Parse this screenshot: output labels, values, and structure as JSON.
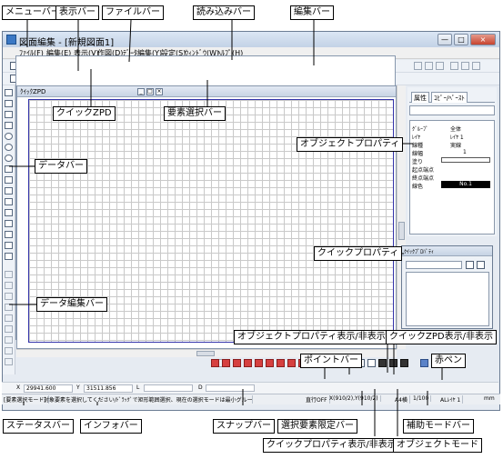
{
  "window": {
    "title": "図面編集 - [新規図面1]",
    "buttons": [
      "—",
      "□",
      "×"
    ]
  },
  "menu": [
    "ﾌｧｲﾙ(F)",
    "編集(E)",
    "表示(V)",
    "作図(D)",
    "ﾃﾞｰﾀ編集(Y)",
    "設定(S)",
    "ｳｨﾝﾄﾞｳ(W)",
    "ﾍﾙﾌﾟ(H)"
  ],
  "document": {
    "title": "ｸｲｯｸZPD",
    "buttons": [
      "_",
      "□",
      "×"
    ]
  },
  "right_panel": {
    "tabs": [
      "属性",
      "ｺﾋﾟｰ/ﾍﾟｰｽﾄ"
    ],
    "properties": [
      {
        "label": "ｸﾞﾙｰﾌﾟ",
        "value": "全体"
      },
      {
        "label": "ﾚｲﾔ",
        "value": "ﾚｲﾔ 1"
      },
      {
        "label": "線種",
        "value": "実線"
      },
      {
        "label": "線幅",
        "value": "1"
      },
      {
        "label": "塗り",
        "value": ""
      },
      {
        "label": "起点端点",
        "value": ""
      },
      {
        "label": "終点端点",
        "value": ""
      },
      {
        "label": "線色",
        "value": "No.1"
      }
    ]
  },
  "quick_property": {
    "title": "ｸｲｯｸﾌﾟﾛﾊﾟﾃｨ"
  },
  "coords": {
    "x_label": "X",
    "x_value": "29941.600",
    "y_label": "Y",
    "y_value": "31511.856",
    "l_label": "L",
    "d_label": "D"
  },
  "status": {
    "mode": "[要素選択モード]",
    "message": "対象要素を選択してください/ﾄﾞﾗｯｸﾞで矩形範囲選択、現在の選択モードは最小グループ要素ですよ F8 キー",
    "snap": "直行OFF",
    "xy": "X(910/2),Y(910/2)",
    "a4": "A4横",
    "scale": "1/100",
    "layer": "ALﾚｲﾔ 1",
    "unit": "mm"
  },
  "callouts": {
    "menu_bar": "メニューバー",
    "view_bar": "表示バー",
    "file_bar": "ファイルバー",
    "read_bar": "読み込みバー",
    "edit_bar": "編集バー",
    "quick_zpd": "クイックZPD",
    "element_select_bar": "要素選択バー",
    "object_property": "オブジェクトプロパティ",
    "data_bar": "データバー",
    "quick_property": "クイックプロパティ",
    "data_edit_bar": "データ編集バー",
    "object_property_toggle": "オブジェクトプロパティ表示/非表示",
    "quick_zpd_toggle": "クイックZPD表示/非表示",
    "point_bar": "ポイントバー",
    "red_pen": "赤ペン",
    "status_bar": "ステータスバー",
    "info_bar": "インフォバー",
    "snap_bar": "スナップバー",
    "select_limit_bar": "選択要素限定バー",
    "aux_mode_bar": "補助モードバー",
    "quick_property_toggle": "クイックプロパティ表示/非表示",
    "object_mode": "オブジェクトモード"
  }
}
